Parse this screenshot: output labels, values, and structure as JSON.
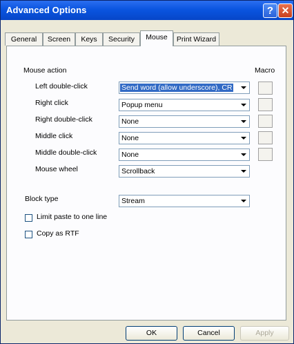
{
  "window": {
    "title": "Advanced Options",
    "help_glyph": "?",
    "close_glyph": "✕"
  },
  "tabs": [
    "General",
    "Screen",
    "Keys",
    "Security",
    "Mouse",
    "Print Wizard"
  ],
  "active_tab": "Mouse",
  "mouse_action": {
    "heading": "Mouse action",
    "macro_label": "Macro",
    "rows": [
      {
        "label": "Left double-click",
        "value": "Send word (allow underscore), CR",
        "macro": true
      },
      {
        "label": "Right click",
        "value": "Popup menu",
        "macro": true
      },
      {
        "label": "Right double-click",
        "value": "None",
        "macro": true
      },
      {
        "label": "Middle click",
        "value": "None",
        "macro": true
      },
      {
        "label": "Middle double-click",
        "value": "None",
        "macro": true
      },
      {
        "label": "Mouse wheel",
        "value": "Scrollback",
        "macro": false
      }
    ]
  },
  "block_type": {
    "label": "Block type",
    "value": "Stream"
  },
  "checkboxes": [
    {
      "label": "Limit paste to one line",
      "checked": false
    },
    {
      "label": "Copy as RTF",
      "checked": false
    }
  ],
  "buttons": {
    "ok": "OK",
    "cancel": "Cancel",
    "apply": "Apply"
  }
}
